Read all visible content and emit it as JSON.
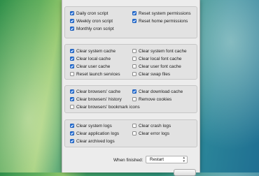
{
  "group1": {
    "items": [
      {
        "label": "Daily cron script",
        "checked": true
      },
      {
        "label": "Reset system permissions",
        "checked": true
      },
      {
        "label": "Weekly cron script",
        "checked": true
      },
      {
        "label": "Reset home permissions",
        "checked": true
      },
      {
        "label": "Monthly cron script",
        "checked": true
      }
    ]
  },
  "group2": {
    "items": [
      {
        "label": "Clear system cache",
        "checked": true
      },
      {
        "label": "Clear system font cache",
        "checked": false
      },
      {
        "label": "Clear local cache",
        "checked": true
      },
      {
        "label": "Clear local font cache",
        "checked": false
      },
      {
        "label": "Clear user cache",
        "checked": true
      },
      {
        "label": "Clear user font cache",
        "checked": false
      },
      {
        "label": "Reset launch services",
        "checked": false
      },
      {
        "label": "Clear swap files",
        "checked": false
      }
    ]
  },
  "group3": {
    "items": [
      {
        "label": "Clear browsers' cache",
        "checked": true
      },
      {
        "label": "Clear download cache",
        "checked": true
      },
      {
        "label": "Clear browsers' history",
        "checked": true
      },
      {
        "label": "Remove cookies",
        "checked": false
      },
      {
        "label": "Clear browsers' bookmark icons",
        "checked": false
      }
    ]
  },
  "group4": {
    "items": [
      {
        "label": "Clear system logs",
        "checked": true
      },
      {
        "label": "Clear crash logs",
        "checked": false
      },
      {
        "label": "Clear application logs",
        "checked": true
      },
      {
        "label": "Clear error logs",
        "checked": false
      },
      {
        "label": "Clear archived logs",
        "checked": true
      }
    ]
  },
  "finish": {
    "label": "When finished:",
    "selected": "Restart"
  },
  "colors": {
    "accent": "#2a73d8"
  }
}
